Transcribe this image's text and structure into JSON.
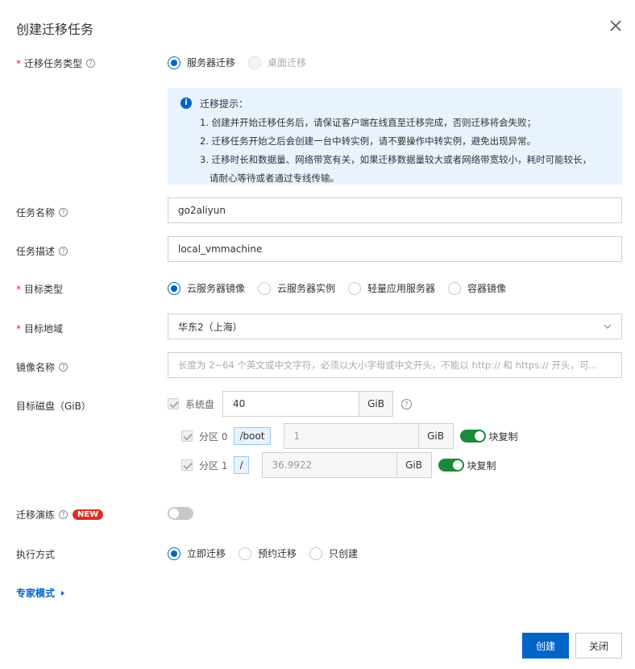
{
  "dialog": {
    "title": "创建迁移任务"
  },
  "migration_type": {
    "label": "迁移任务类型",
    "options": [
      "服务器迁移",
      "桌面迁移"
    ],
    "selected": "服务器迁移"
  },
  "tip": {
    "title": "迁移提示：",
    "lines": [
      "1. 创建并开始迁移任务后，请保证客户端在线直至迁移完成，否则迁移将会失败；",
      "2. 迁移任务开始之后会创建一台中转实例，请不要操作中转实例，避免出现异常。",
      "3. 迁移时长和数据量、网络带宽有关，如果迁移数据量较大或者网络带宽较小，耗时可能较长，",
      "请耐心等待或者通过专线传输。"
    ]
  },
  "task_name": {
    "label": "任务名称",
    "value": "go2aliyun"
  },
  "task_desc": {
    "label": "任务描述",
    "value": "local_vmmachine"
  },
  "target_type": {
    "label": "目标类型",
    "options": [
      "云服务器镜像",
      "云服务器实例",
      "轻量应用服务器",
      "容器镜像"
    ],
    "selected": "云服务器镜像"
  },
  "target_region": {
    "label": "目标地域",
    "value": "华东2（上海）"
  },
  "image_name": {
    "label": "镜像名称",
    "placeholder": "长度为 2~64 个英文或中文字符，必须以大小字母或中文开头，不能以 http:// 和 https:// 开头，可..."
  },
  "target_disk": {
    "label": "目标磁盘（GiB）",
    "system_disk": {
      "label": "系统盘",
      "value": "40",
      "unit": "GiB"
    },
    "partitions": [
      {
        "label": "分区 0",
        "mount": "/boot",
        "value": "1",
        "unit": "GiB",
        "block_copy": "块复制",
        "block_copy_on": true
      },
      {
        "label": "分区 1",
        "mount": "/",
        "value": "36.9922",
        "unit": "GiB",
        "block_copy": "块复制",
        "block_copy_on": true
      }
    ]
  },
  "drill": {
    "label": "迁移演练",
    "badge": "NEW",
    "enabled": false
  },
  "execution": {
    "label": "执行方式",
    "options": [
      "立即迁移",
      "预约迁移",
      "只创建"
    ],
    "selected": "立即迁移"
  },
  "expert_mode": {
    "label": "专家模式"
  },
  "buttons": {
    "create": "创建",
    "close": "关闭"
  },
  "colors": {
    "primary": "#0064c8",
    "required": "#d93026",
    "tip_bg": "#e8f3fe",
    "switch_on": "#1a8b3a"
  }
}
